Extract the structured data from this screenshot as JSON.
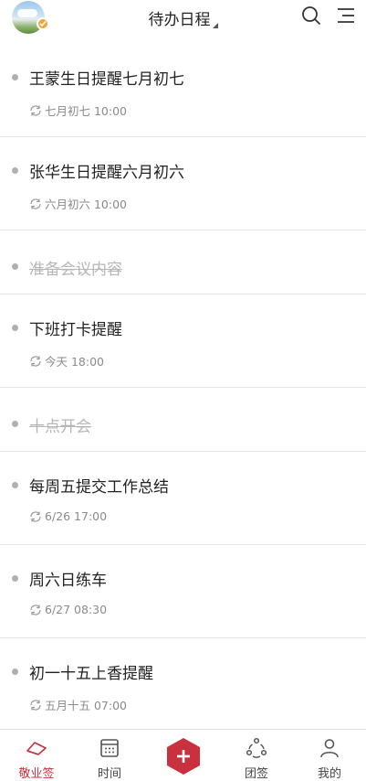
{
  "header": {
    "title": "待办日程",
    "avatar_icon": "user-avatar",
    "search_icon": "search-icon",
    "menu_icon": "menu-icon"
  },
  "todos": [
    {
      "title": "王蒙生日提醒七月初七",
      "time": "七月初七 10:00",
      "done": false
    },
    {
      "title": "张华生日提醒六月初六",
      "time": "六月初六 10:00",
      "done": false
    },
    {
      "title": "准备会议内容",
      "time": "",
      "done": true
    },
    {
      "title": "下班打卡提醒",
      "time": "今天 18:00",
      "done": false
    },
    {
      "title": "十点开会",
      "time": "",
      "done": true
    },
    {
      "title": "每周五提交工作总结",
      "time": "6/26 17:00",
      "done": false
    },
    {
      "title": "周六日练车",
      "time": "6/27 08:30",
      "done": false
    },
    {
      "title": "初一十五上香提醒",
      "time": "五月十五 07:00",
      "done": false
    }
  ],
  "nav": {
    "items": [
      {
        "label": "敬业签",
        "icon": "note-icon",
        "active": true
      },
      {
        "label": "时间",
        "icon": "calendar-icon",
        "active": false
      },
      {
        "label": "",
        "icon": "add-icon",
        "active": false
      },
      {
        "label": "团签",
        "icon": "team-icon",
        "active": false
      },
      {
        "label": "我的",
        "icon": "profile-icon",
        "active": false
      }
    ]
  },
  "colors": {
    "accent": "#c8313d",
    "done_text": "#b6b6b6",
    "meta_text": "#8a8a8a",
    "badge": "#f0a63a"
  }
}
